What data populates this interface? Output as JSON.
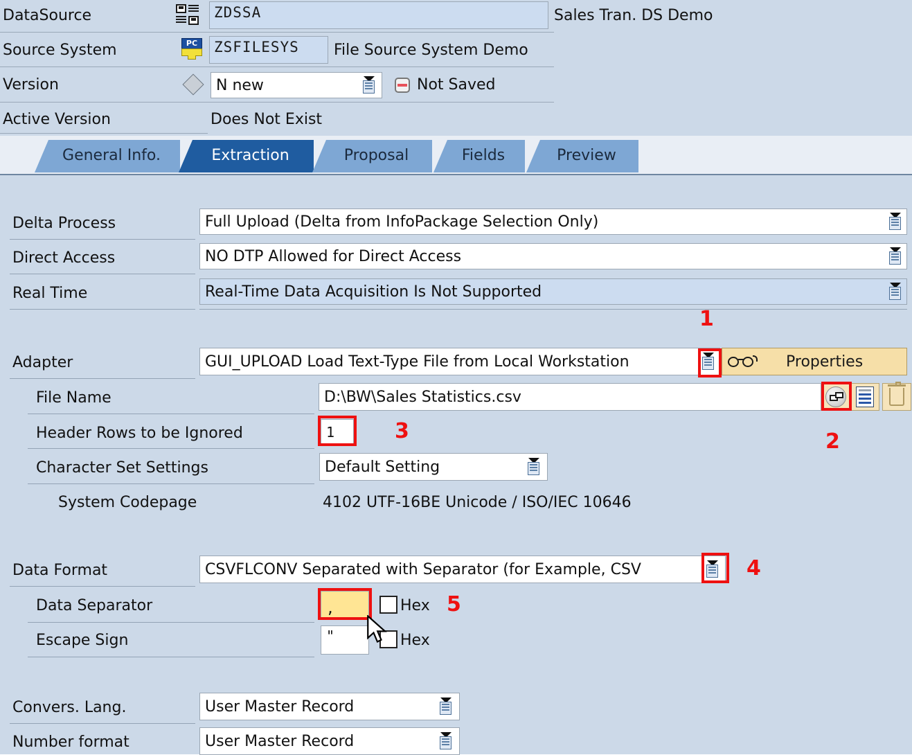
{
  "header": {
    "datasource": {
      "label": "DataSource",
      "value": "ZDSSA",
      "description": "Sales Tran. DS Demo",
      "icon": "datasource-icon"
    },
    "source_system": {
      "label": "Source System",
      "value": "ZSFILESYS",
      "description": "File Source System Demo",
      "icon": "source-system-icon"
    },
    "version": {
      "label": "Version",
      "value": "N new",
      "status": "Not Saved",
      "icon": "diamond-icon",
      "status_icon": "not-saved-icon"
    },
    "active_version": {
      "label": "Active Version",
      "value": "Does Not Exist"
    }
  },
  "tabs": [
    {
      "label": "General Info.",
      "active": false
    },
    {
      "label": "Extraction",
      "active": true
    },
    {
      "label": "Proposal",
      "active": false
    },
    {
      "label": "Fields",
      "active": false
    },
    {
      "label": "Preview",
      "active": false
    }
  ],
  "extraction": {
    "delta_process": {
      "label": "Delta Process",
      "value": "Full Upload (Delta from InfoPackage Selection Only)"
    },
    "direct_access": {
      "label": "Direct Access",
      "value": "NO DTP Allowed for Direct Access"
    },
    "real_time": {
      "label": "Real Time",
      "value": "Real-Time Data Acquisition Is Not Supported"
    },
    "adapter": {
      "label": "Adapter",
      "value": "GUI_UPLOAD Load Text-Type File from Local Workstation"
    },
    "properties_button": {
      "label": "Properties",
      "icon": "glasses-icon"
    },
    "file_name": {
      "label": "File Name",
      "value": "D:\\BW\\Sales Statistics.csv"
    },
    "header_rows": {
      "label": "Header Rows to be Ignored",
      "value": "1"
    },
    "character_set": {
      "label": "Character Set Settings",
      "value": "Default Setting"
    },
    "system_codepage": {
      "label": "System Codepage",
      "value": "4102  UTF-16BE Unicode / ISO/IEC 10646"
    },
    "data_format": {
      "label": "Data Format",
      "value": "CSVFLCONV Separated with Separator (for Example, CSV"
    },
    "data_separator": {
      "label": "Data Separator",
      "value": ",",
      "hex_label": "Hex"
    },
    "escape_sign": {
      "label": "Escape Sign",
      "value": "\"",
      "hex_label": "Hex"
    },
    "convers_lang": {
      "label": "Convers. Lang.",
      "value": "User Master Record"
    },
    "number_format": {
      "label": "Number format",
      "value": "User Master Record"
    }
  },
  "annotations": [
    {
      "number": "1"
    },
    {
      "number": "2"
    },
    {
      "number": "3"
    },
    {
      "number": "4"
    },
    {
      "number": "5"
    }
  ],
  "colors": {
    "panel_bg": "#ccd9e8",
    "tab_active": "#1f5ca0",
    "tab_inactive": "#7ea7d4",
    "annotation_red": "#ee1111",
    "highlight_yellow": "#ffe594",
    "button_tan": "#f6dfa8"
  }
}
